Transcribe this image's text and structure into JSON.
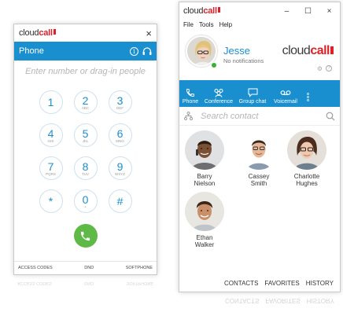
{
  "phone_window": {
    "logo": {
      "prefix": "cloud",
      "brand": "call"
    },
    "close_glyph": "×",
    "header_title": "Phone",
    "dial_placeholder": "Enter number or drag-in people",
    "keys": [
      {
        "digit": "1",
        "letters": ""
      },
      {
        "digit": "2",
        "letters": "ABC"
      },
      {
        "digit": "3",
        "letters": "DEF"
      },
      {
        "digit": "4",
        "letters": "GHI"
      },
      {
        "digit": "5",
        "letters": "JKL"
      },
      {
        "digit": "6",
        "letters": "MNO"
      },
      {
        "digit": "7",
        "letters": "PQRS"
      },
      {
        "digit": "8",
        "letters": "TUV"
      },
      {
        "digit": "9",
        "letters": "WXYZ"
      },
      {
        "digit": "*",
        "letters": ""
      },
      {
        "digit": "0",
        "letters": "+"
      },
      {
        "digit": "#",
        "letters": ""
      }
    ],
    "footer": {
      "access_codes": "ACCESS CODES",
      "dnd": "DND",
      "softphone": "SOFTPHONE"
    },
    "colors": {
      "header": "#1a8fd0",
      "call": "#5fb946"
    }
  },
  "main_window": {
    "logo": {
      "prefix": "cloud",
      "brand": "call"
    },
    "controls": {
      "minimize": "–",
      "maximize": "☐",
      "close": "×"
    },
    "menu": {
      "file": "File",
      "tools": "Tools",
      "help": "Help"
    },
    "profile": {
      "name": "Jesse",
      "status": "No notifications",
      "status_color": "#34b334"
    },
    "nav": [
      {
        "label": "Phone",
        "icon": "phone-icon"
      },
      {
        "label": "Conference",
        "icon": "conference-icon"
      },
      {
        "label": "Group chat",
        "icon": "chat-icon"
      },
      {
        "label": "Voicemail",
        "icon": "voicemail-icon"
      }
    ],
    "search_placeholder": "Search contact",
    "contacts": [
      {
        "first": "Barry",
        "last": "Nielson"
      },
      {
        "first": "Cassey",
        "last": "Smith"
      },
      {
        "first": "Charlotte",
        "last": "Hughes"
      },
      {
        "first": "Ethan",
        "last": "Walker"
      }
    ],
    "footer": {
      "contacts": "CONTACTS",
      "favorites": "FAVORITES",
      "history": "HISTORY"
    },
    "colors": {
      "brand_blue": "#1a8fd0",
      "brand_red": "#e01f26"
    }
  }
}
